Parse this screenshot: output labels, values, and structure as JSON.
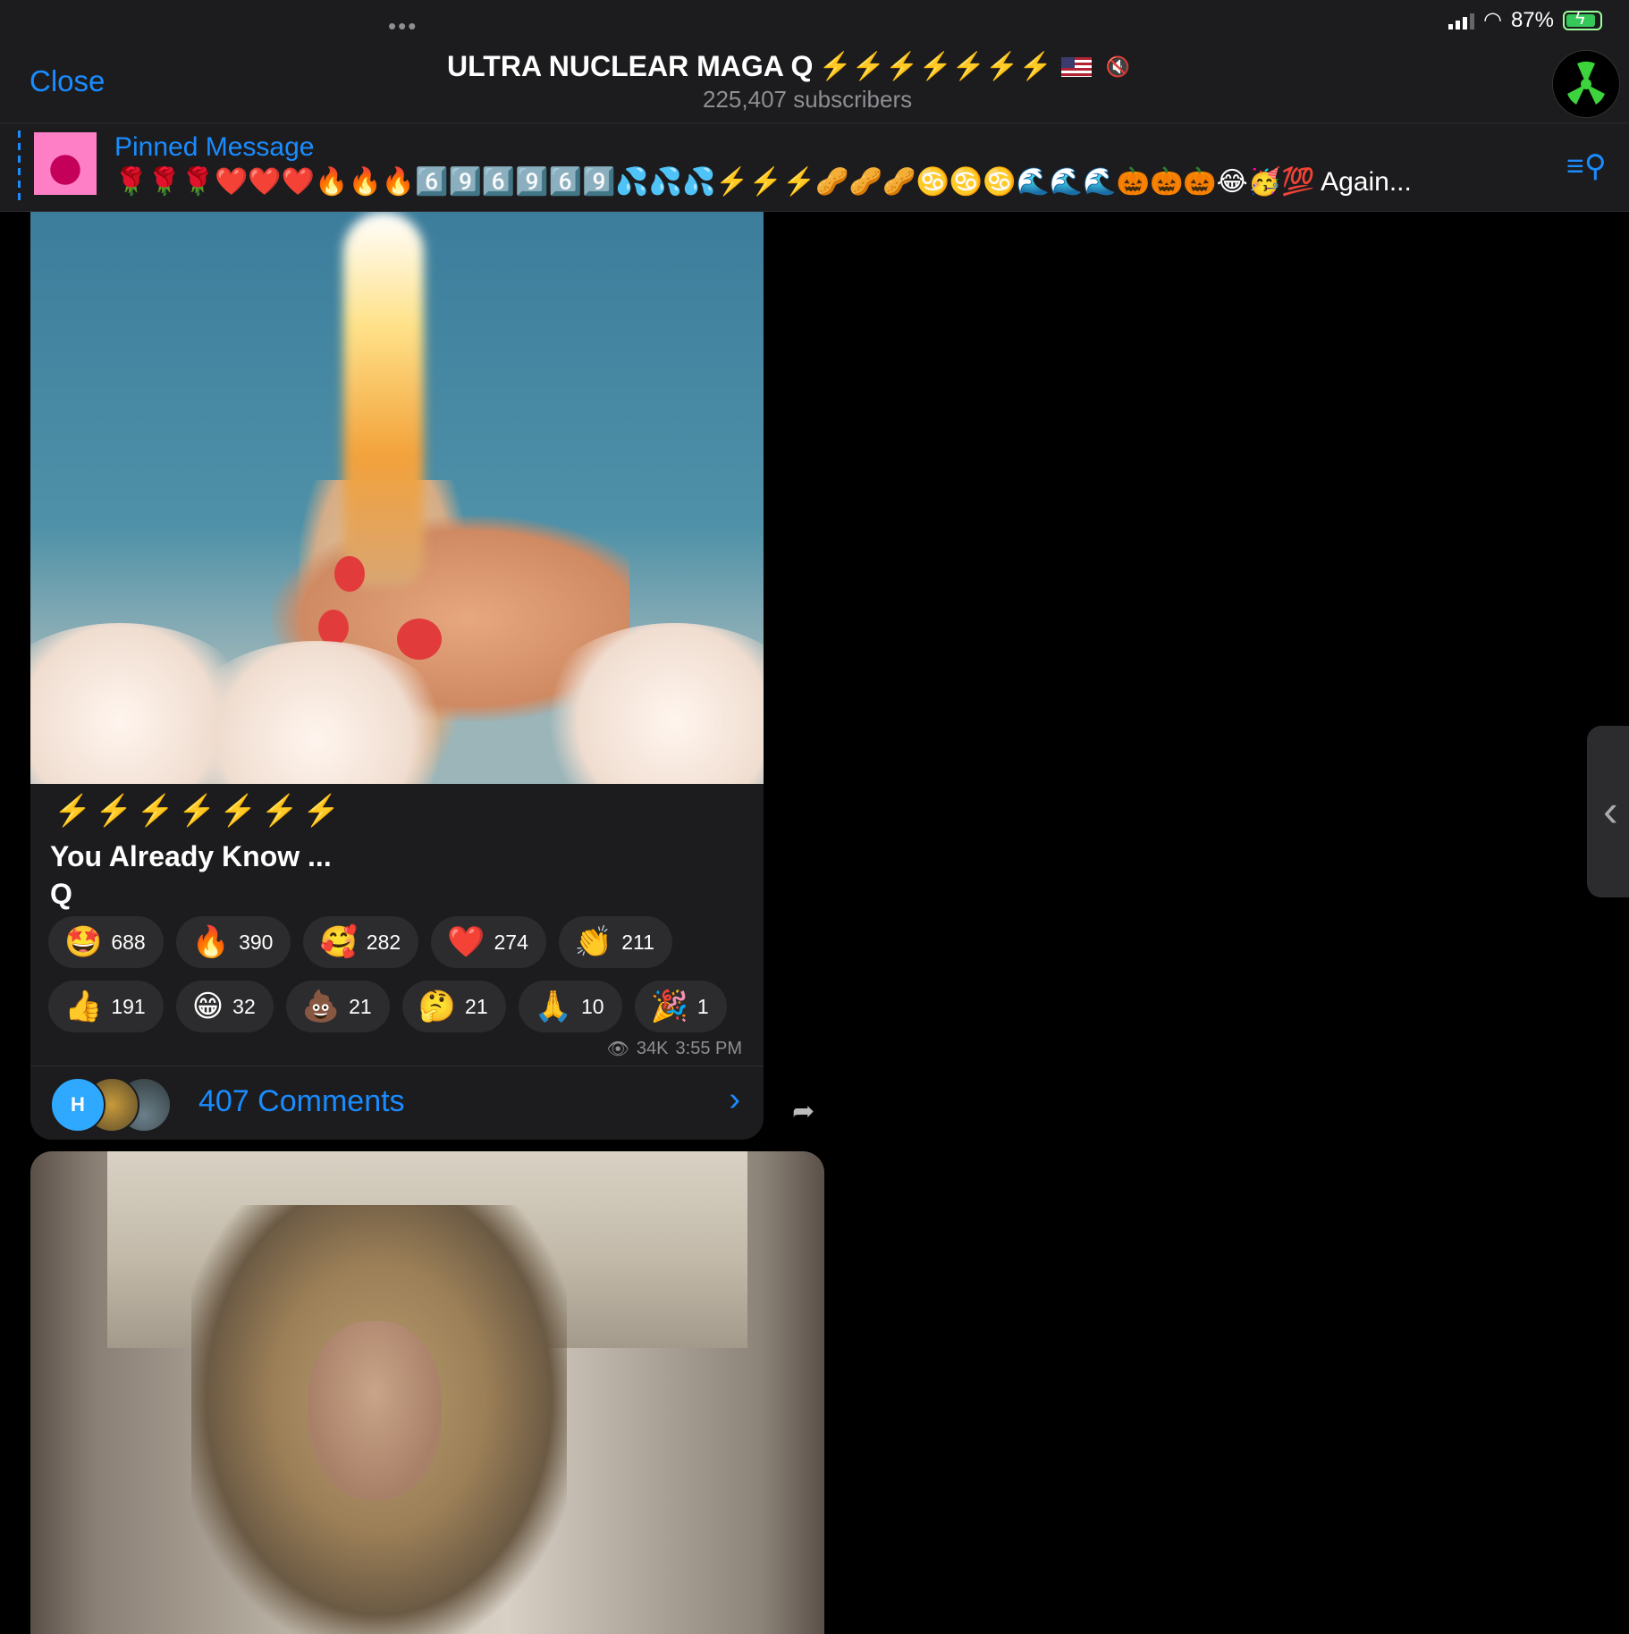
{
  "status_bar": {
    "battery_percent": "87%"
  },
  "header": {
    "close_label": "Close",
    "title": "ULTRA NUCLEAR MAGA Q",
    "title_emojis": "⚡️⚡️⚡️⚡️⚡️⚡️⚡️",
    "subscribers": "225,407 subscribers"
  },
  "pinned": {
    "label": "Pinned Message",
    "text": "🌹🌹🌹❤️❤️❤️🔥🔥🔥6️⃣9️⃣6️⃣9️⃣6️⃣9️⃣💦💦💦⚡️⚡️⚡️🥜🥜🥜♋️♋️♋️🌊🌊🌊🎃🎃🎃😂🥳💯 Again..."
  },
  "post1": {
    "caption_emojis": "⚡️⚡️⚡️⚡️⚡️⚡️⚡️",
    "caption": "You Already Know ...\nQ",
    "reactions_row1": [
      {
        "emoji": "🤩",
        "count": "688"
      },
      {
        "emoji": "🔥",
        "count": "390"
      },
      {
        "emoji": "🥰",
        "count": "282"
      },
      {
        "emoji": "❤️",
        "count": "274"
      },
      {
        "emoji": "👏",
        "count": "211"
      }
    ],
    "reactions_row2": [
      {
        "emoji": "👍",
        "count": "191"
      },
      {
        "emoji": "😁",
        "count": "32"
      },
      {
        "emoji": "💩",
        "count": "21"
      },
      {
        "emoji": "🤔",
        "count": "21"
      },
      {
        "emoji": "🙏",
        "count": "10"
      },
      {
        "emoji": "🎉",
        "count": "1"
      }
    ],
    "views": "34K",
    "time": "3:55 PM",
    "comments_label": "407 Comments",
    "commenter_initial": "H"
  },
  "colors": {
    "accent": "#1a8cff",
    "background": "#000000",
    "bubble": "#1c1c1e"
  }
}
